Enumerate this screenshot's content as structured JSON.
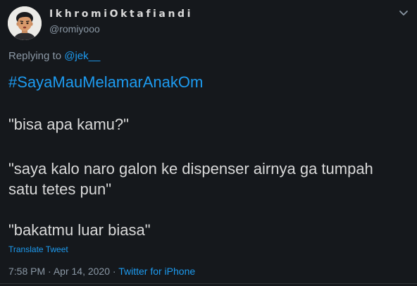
{
  "tweet": {
    "author": {
      "display_name": "IkhromiOktafiandi",
      "handle": "@romiyooo"
    },
    "reply": {
      "prefix": "Replying to",
      "mention": "@jek__"
    },
    "hashtag": "#SayaMauMelamarAnakOm",
    "lines": [
      "\"bisa apa kamu?\"",
      "\"saya kalo naro galon ke dispenser airnya ga tumpah",
      "satu tetes pun\"",
      "\"bakatmu luar biasa\""
    ],
    "translate_label": "Translate Tweet",
    "time": "7:58 PM",
    "separator": "·",
    "date": "Apr 14, 2020",
    "source": "Twitter for iPhone"
  },
  "icons": {
    "avatar": "memoji-avatar",
    "menu": "chevron-down-icon"
  },
  "colors": {
    "background": "#15181c",
    "text": "#d9d9d9",
    "muted": "#8b98a5",
    "link": "#1d9bf0"
  }
}
